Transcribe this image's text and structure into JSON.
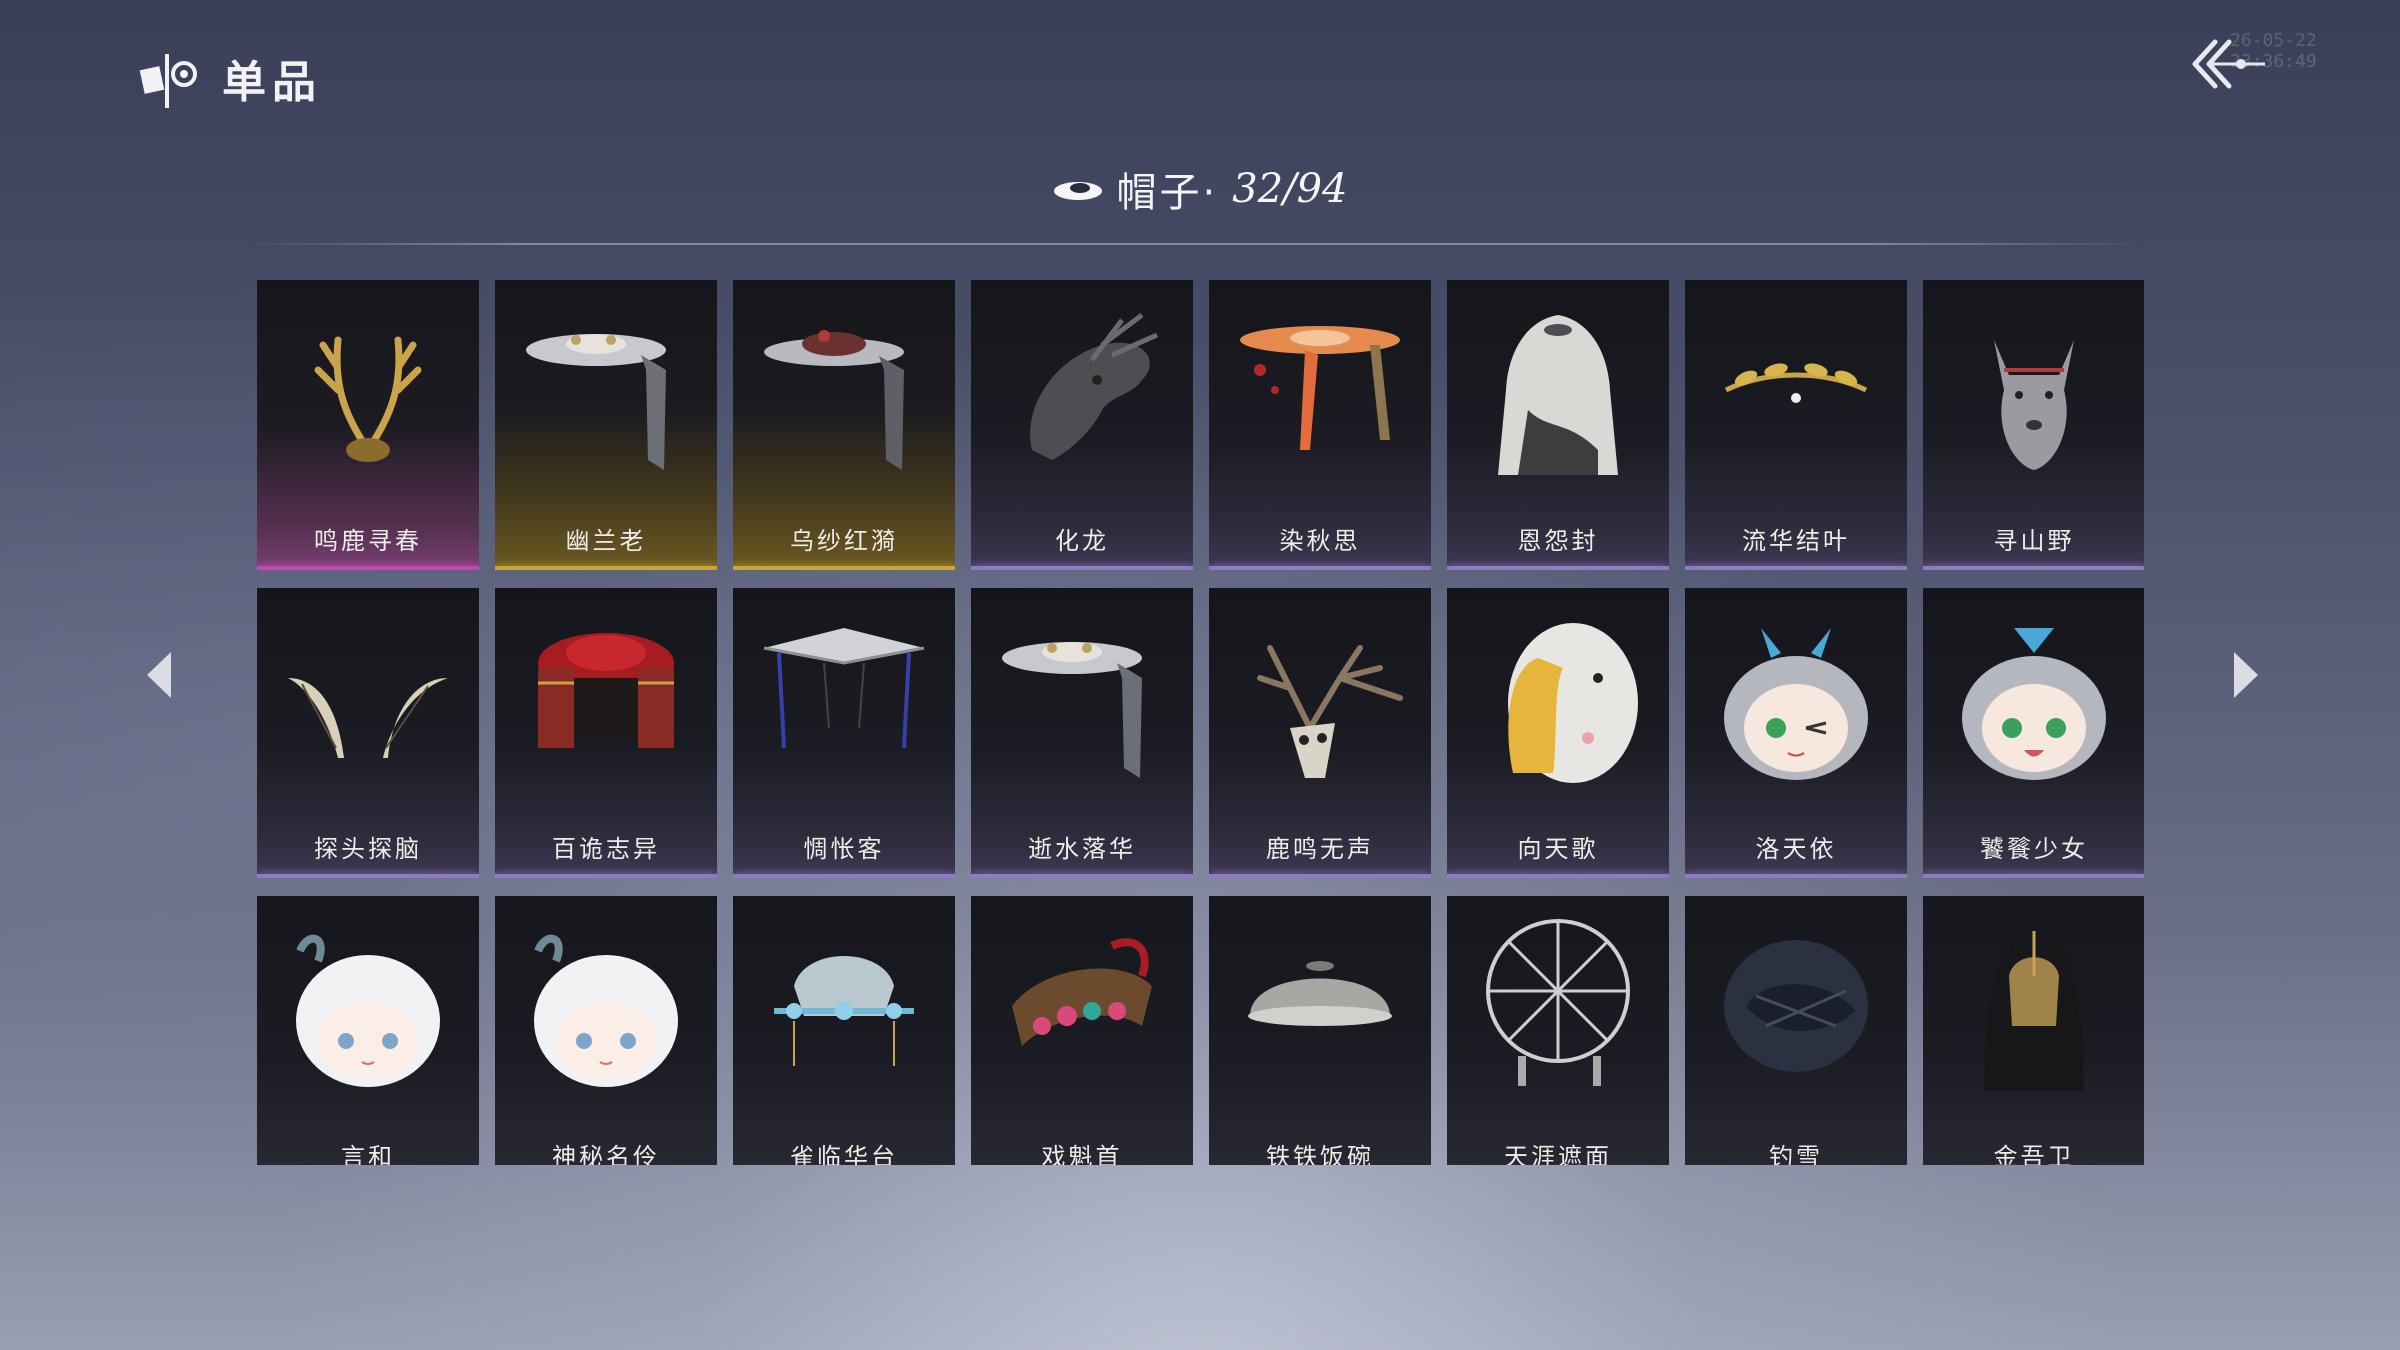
{
  "header": {
    "title": "单品",
    "logo_icon": "wardrobe-logo-icon",
    "back_icon": "back-arrow-icon"
  },
  "watermark": "26-05-22 23:36:49",
  "category": {
    "icon": "hat-icon",
    "label": "帽子·",
    "count": "32/94"
  },
  "pager": {
    "prev_icon": "triangle-left-icon",
    "next_icon": "triangle-right-icon"
  },
  "items": [
    {
      "name": "鸣鹿寻春",
      "tier": "pink",
      "icon": "golden-antlers-icon"
    },
    {
      "name": "幽兰老",
      "tier": "gold",
      "icon": "veiled-bamboo-hat-icon"
    },
    {
      "name": "乌纱红漪",
      "tier": "gold",
      "icon": "red-veiled-hat-icon"
    },
    {
      "name": "化龙",
      "tier": "purple",
      "icon": "dragon-head-icon"
    },
    {
      "name": "染秋思",
      "tier": "purple",
      "icon": "orange-fringed-hat-icon"
    },
    {
      "name": "恩怨封",
      "tier": "purple",
      "icon": "ink-hood-icon"
    },
    {
      "name": "流华结叶",
      "tier": "purple",
      "icon": "golden-leaf-circlet-icon"
    },
    {
      "name": "寻山野",
      "tier": "purple",
      "icon": "wolf-head-icon"
    },
    {
      "name": "探头探脑",
      "tier": "purple",
      "icon": "feather-antennae-icon"
    },
    {
      "name": "百诡志异",
      "tier": "purple",
      "icon": "red-canopy-hat-icon"
    },
    {
      "name": "惆怅客",
      "tier": "purple",
      "icon": "bamboo-hat-ribbons-icon"
    },
    {
      "name": "逝水落华",
      "tier": "purple",
      "icon": "veiled-bamboo-hat-icon"
    },
    {
      "name": "鹿鸣无声",
      "tier": "purple",
      "icon": "deer-skull-icon"
    },
    {
      "name": "向天歌",
      "tier": "purple",
      "icon": "goose-plush-hat-icon"
    },
    {
      "name": "洛天依",
      "tier": "purple",
      "icon": "chibi-head-wink-icon"
    },
    {
      "name": "饕餮少女",
      "tier": "purple",
      "icon": "chibi-head-smile-icon"
    },
    {
      "name": "言和",
      "tier": "plain",
      "icon": "chibi-white-hair-icon"
    },
    {
      "name": "神秘名伶",
      "tier": "plain",
      "icon": "chibi-white-hair-icon"
    },
    {
      "name": "雀临华台",
      "tier": "plain",
      "icon": "jeweled-crown-icon"
    },
    {
      "name": "戏魁首",
      "tier": "plain",
      "icon": "opera-headdress-icon"
    },
    {
      "name": "铁铁饭碗",
      "tier": "plain",
      "icon": "iron-bowl-icon"
    },
    {
      "name": "天涯遮面",
      "tier": "plain",
      "icon": "ribbed-umbrella-hat-icon"
    },
    {
      "name": "钓雪",
      "tier": "plain",
      "icon": "straw-hat-icon"
    },
    {
      "name": "金吾卫",
      "tier": "plain",
      "icon": "guard-helmet-icon"
    }
  ]
}
